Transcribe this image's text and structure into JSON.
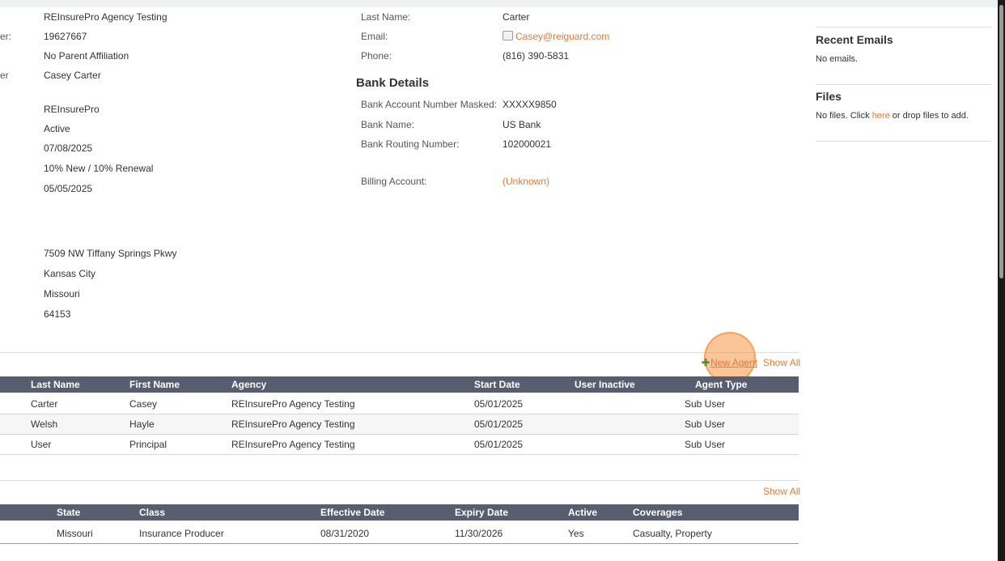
{
  "left_details": {
    "cut_labels": [
      "er:",
      "er"
    ],
    "agency_name": "REInsurePro Agency Testing",
    "number": "19627667",
    "parent": "No Parent Affiliation",
    "owner": "Casey Carter",
    "brand": "REInsurePro",
    "status": "Active",
    "date1": "07/08/2025",
    "commission": "10% New / 10% Renewal",
    "date2": "05/05/2025",
    "address_line": "7509 NW Tiffany Springs Pkwy",
    "city": "Kansas City",
    "state": "Missouri",
    "zip": "64153"
  },
  "contact": {
    "last_name_label": "Last Name:",
    "last_name": "Carter",
    "email_label": "Email:",
    "email": "Casey@reiguard.com",
    "phone_label": "Phone:",
    "phone": "(816) 390-5831"
  },
  "bank": {
    "title": "Bank Details",
    "account_label": "Bank Account Number Masked:",
    "account": "XXXXX9850",
    "name_label": "Bank Name:",
    "name": "US Bank",
    "routing_label": "Bank Routing Number:",
    "routing": "102000021",
    "billing_label": "Billing Account:",
    "billing": "(Unknown)"
  },
  "sidebar": {
    "recent_emails_title": "Recent Emails",
    "recent_emails_empty": "No emails.",
    "files_title": "Files",
    "files_text_before": "No files. Click ",
    "files_link": "here",
    "files_text_after": " or drop files to add."
  },
  "agents": {
    "new_agent": "New Agent",
    "show_all": "Show All",
    "columns": [
      "Last Name",
      "First Name",
      "Agency",
      "Start Date",
      "User Inactive",
      "Agent Type"
    ],
    "rows": [
      [
        "Carter",
        "Casey",
        "REInsurePro Agency Testing",
        "05/01/2025",
        "",
        "Sub User"
      ],
      [
        "Welsh",
        "Hayle",
        "REInsurePro Agency Testing",
        "05/01/2025",
        "",
        "Sub User"
      ],
      [
        "User",
        "Principal",
        "REInsurePro Agency Testing",
        "05/01/2025",
        "",
        "Sub User"
      ]
    ]
  },
  "licenses": {
    "show_all": "Show All",
    "columns": [
      "State",
      "Class",
      "Effective Date",
      "Expiry Date",
      "Active",
      "Coverages"
    ],
    "rows": [
      [
        "Missouri",
        "Insurance Producer",
        "08/31/2020",
        "11/30/2026",
        "Yes",
        "Casualty, Property"
      ]
    ]
  },
  "colors": {
    "accent": "#e07b39",
    "table_header": "#585e6f",
    "click_highlight": "#f59646"
  }
}
